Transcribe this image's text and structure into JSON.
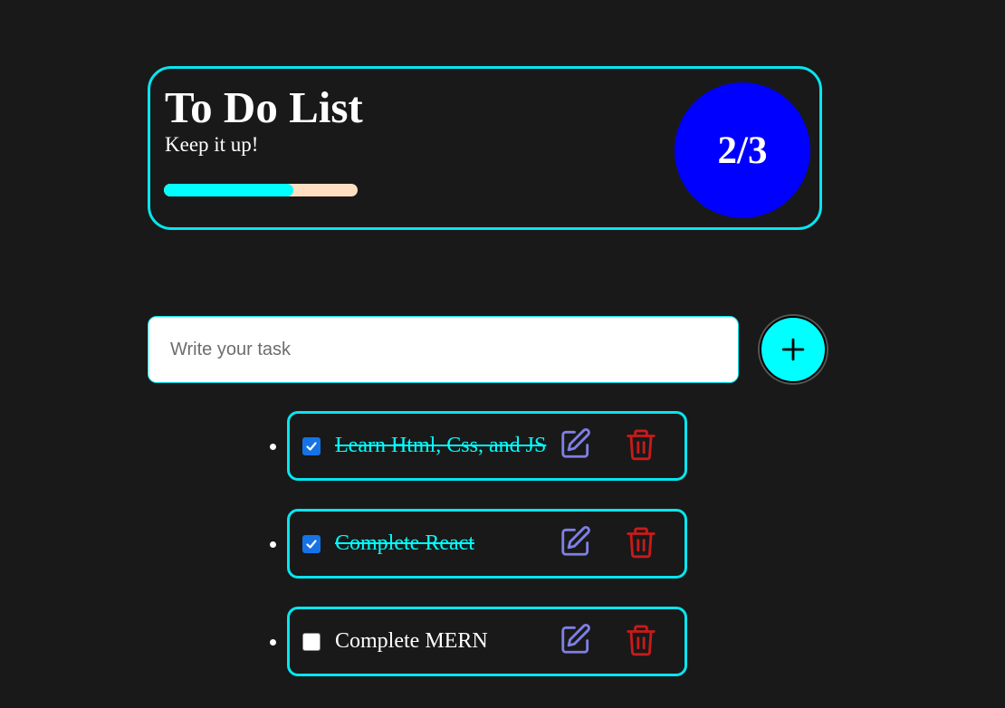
{
  "header": {
    "title": "To Do List",
    "subtitle": "Keep it up!",
    "progress": 0.667,
    "count": "2/3",
    "colors": {
      "accent": "#00ffff",
      "circle": "#0000ff",
      "track": "#ffdfc1"
    }
  },
  "form": {
    "placeholder": "Write your task",
    "add_icon": "plus-icon"
  },
  "tasks": [
    {
      "text": "Learn Html, Css, and JS",
      "completed": true
    },
    {
      "text": "Complete React",
      "completed": true
    },
    {
      "text": "Complete MERN",
      "completed": false
    }
  ],
  "icons": {
    "edit": "edit-icon",
    "delete": "trash-icon"
  },
  "colors": {
    "background": "#191919",
    "border": "#06e6ef",
    "edit": "#7f7fe6",
    "delete": "#c81b1b",
    "checkbox": "#1673e6"
  }
}
